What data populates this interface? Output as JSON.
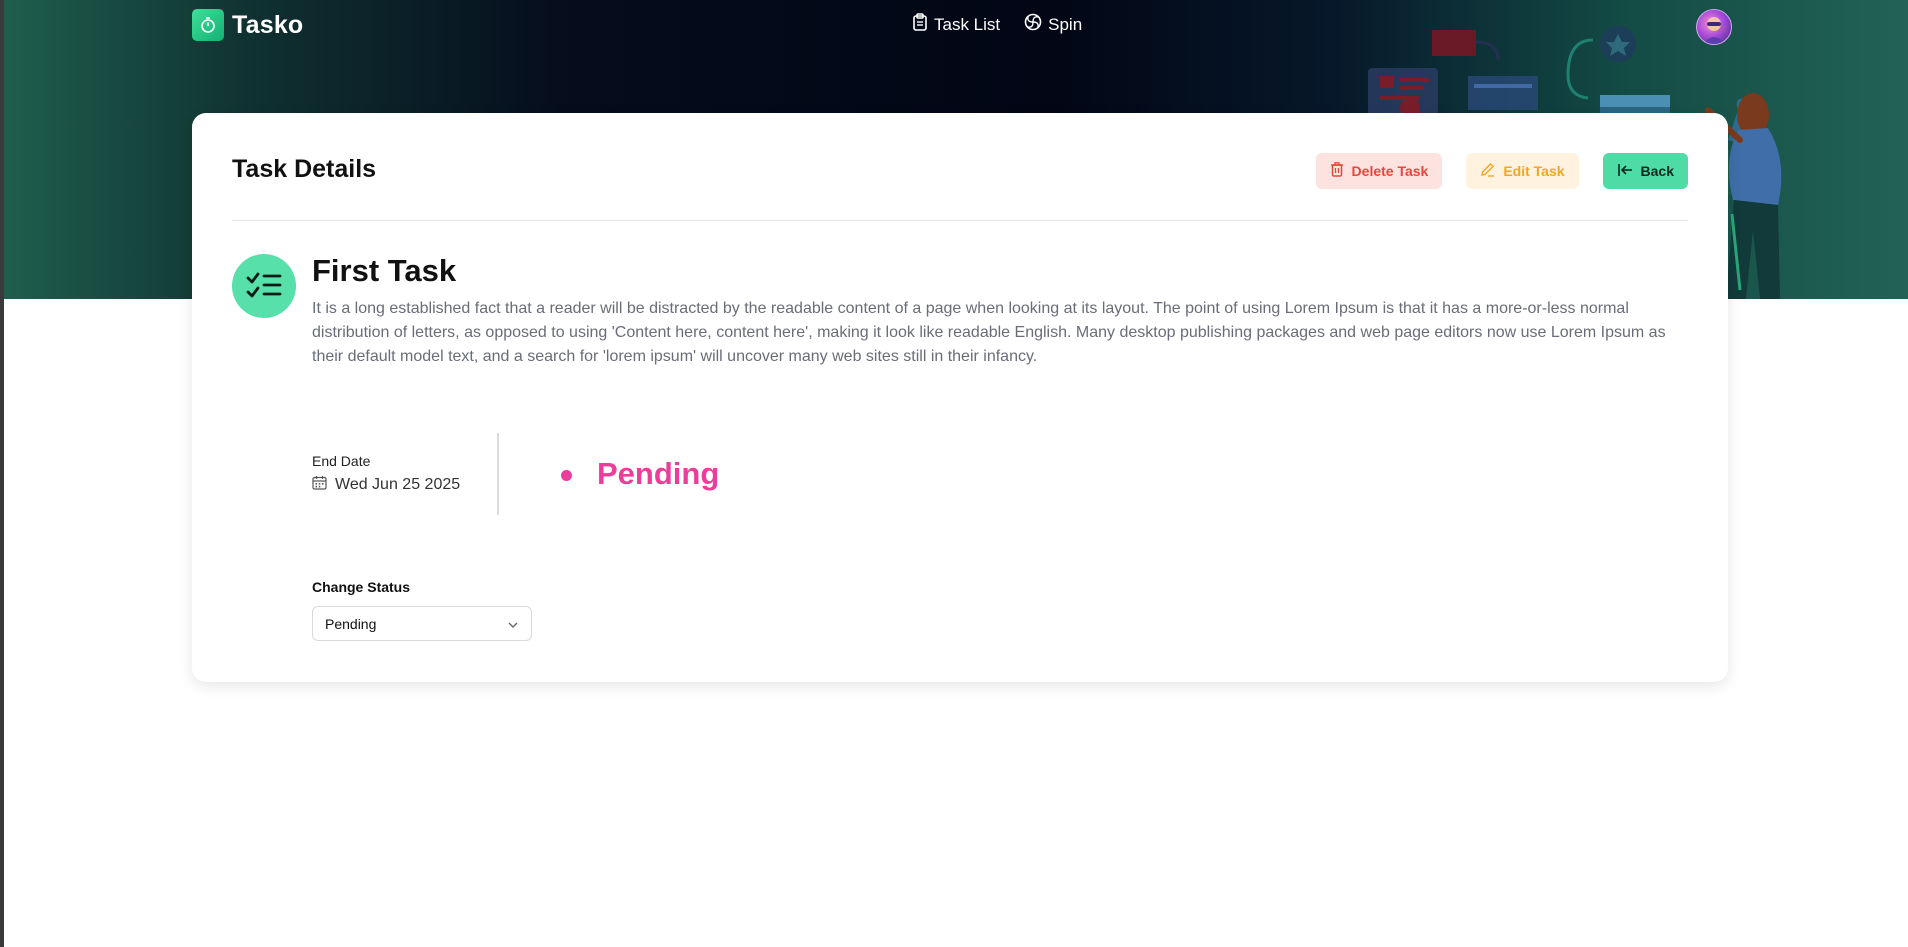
{
  "brand": {
    "name": "Tasko"
  },
  "nav": {
    "links": [
      {
        "label": "Task List",
        "icon": "clipboard-icon"
      },
      {
        "label": "Spin",
        "icon": "spin-icon"
      }
    ]
  },
  "colors": {
    "accent": "#4fdba6",
    "status_pending": "#ec3d9a",
    "delete": "#e5483a",
    "edit": "#f4a524"
  },
  "card": {
    "title": "Task Details",
    "actions": {
      "delete_label": "Delete Task",
      "edit_label": "Edit Task",
      "back_label": "Back"
    }
  },
  "task": {
    "name": "First Task",
    "description": "It is a long established fact that a reader will be distracted by the readable content of a page when looking at its layout. The point of using Lorem Ipsum is that it has a more-or-less normal distribution of letters, as opposed to using 'Content here, content here', making it look like readable English. Many desktop publishing packages and web page editors now use Lorem Ipsum as their default model text, and a search for 'lorem ipsum' will uncover many web sites still in their infancy.",
    "end_date_label": "End Date",
    "end_date": "Wed Jun 25 2025",
    "status": "Pending"
  },
  "change_status": {
    "label": "Change Status",
    "selected": "Pending"
  }
}
